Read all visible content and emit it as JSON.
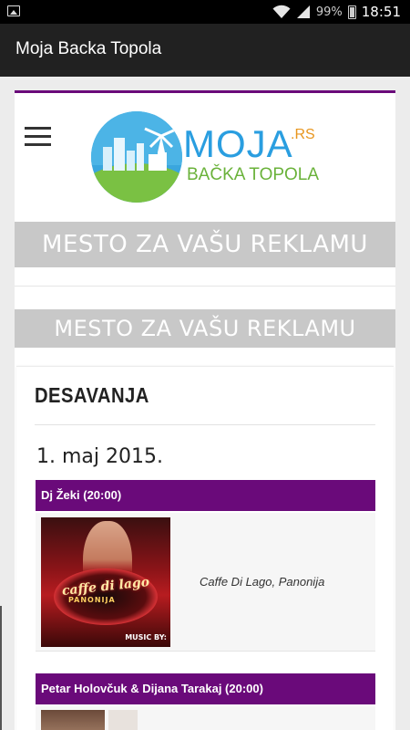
{
  "status_bar": {
    "battery_percent": "99%",
    "time": "18:51",
    "icons": [
      "image-notification-icon",
      "wifi-icon",
      "signal-icon",
      "battery-icon"
    ]
  },
  "app_bar": {
    "title": "Moja Backa Topola"
  },
  "site": {
    "logo": {
      "main": "MOJA",
      "tld": ".RS",
      "sub": "BAČKA TOPOLA"
    },
    "menu_icon": "hamburger-menu-icon",
    "ads": [
      "MESTO ZA VAŠU REKLAMU",
      "MESTO ZA VAŠU REKLAMU"
    ],
    "section": {
      "title": "DESAVANJA",
      "date": "1. maj 2015.",
      "events": [
        {
          "title": "Dj Žeki (20:00)",
          "venue": "Caffe Di Lago, Panonija",
          "poster_text": "caffe di lago",
          "poster_sub": "PANONIJA",
          "poster_music": "MUSIC BY:"
        },
        {
          "title": "Petar Holovčuk & Dijana Tarakaj (20:00)"
        }
      ]
    }
  },
  "colors": {
    "accent_purple": "#6a0a7a",
    "app_bar": "#212121",
    "ad_bg": "#c8c8c8",
    "logo_blue": "#2a9ee0",
    "logo_green": "#6ab23a",
    "logo_orange": "#e8961e"
  }
}
